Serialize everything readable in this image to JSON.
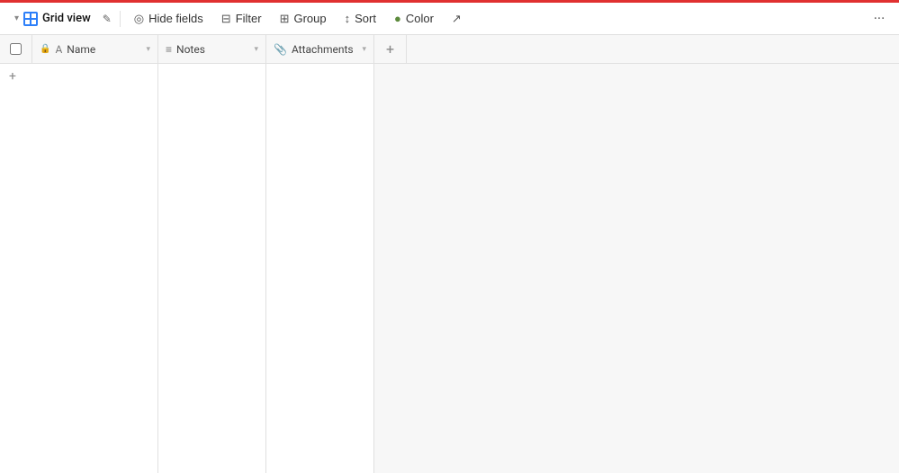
{
  "topbar": {
    "view_name": "Grid view",
    "hide_fields_label": "Hide fields",
    "filter_label": "Filter",
    "group_label": "Group",
    "sort_label": "Sort",
    "color_label": "Color",
    "more_label": "···"
  },
  "columns": {
    "checkbox_label": "",
    "name_label": "Name",
    "notes_label": "Notes",
    "attachments_label": "Attachments",
    "add_col_label": "+"
  },
  "table": {
    "add_row_label": "+"
  },
  "icons": {
    "chevron_down": "▾",
    "hide_icon": "◎",
    "filter_icon": "⊟",
    "group_icon": "⊞",
    "sort_icon": "↕",
    "color_icon": "◉",
    "share_icon": "↗",
    "more_icon": "···",
    "text_type": "A",
    "notes_type": "≡",
    "attach_type": "📎",
    "lock": "🔒",
    "pencil": "✎"
  }
}
